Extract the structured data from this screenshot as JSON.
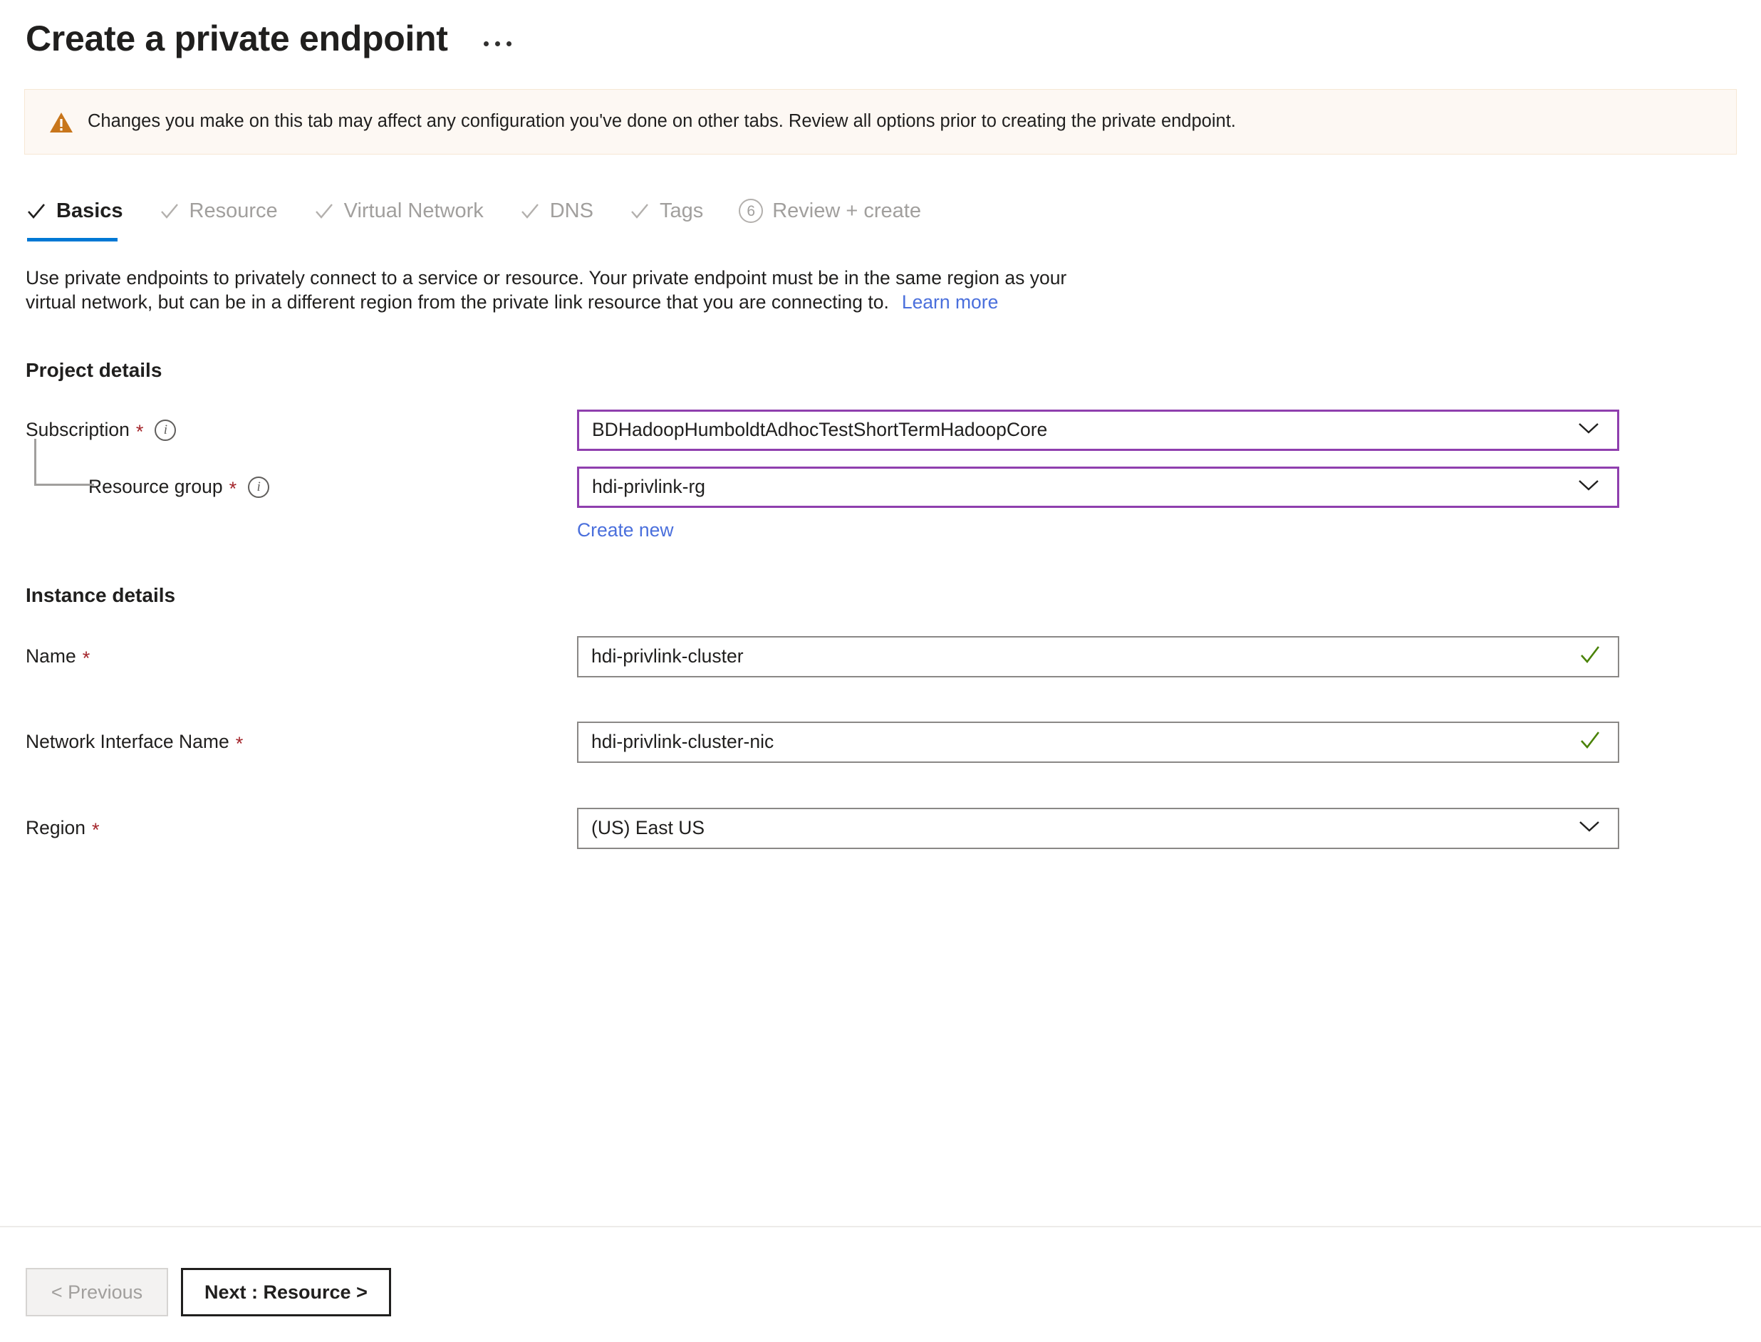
{
  "header": {
    "title": "Create a private endpoint",
    "more_actions": "…"
  },
  "warning": {
    "icon": "warning-triangle-icon",
    "text": "Changes you make on this tab may affect any configuration you've done on other tabs. Review all options prior to creating the private endpoint.",
    "background_color": "#fdf8f3",
    "icon_color": "#c8761b"
  },
  "tabs": [
    {
      "label": "Basics",
      "mark": "check",
      "state": "active"
    },
    {
      "label": "Resource",
      "mark": "check",
      "state": "complete"
    },
    {
      "label": "Virtual Network",
      "mark": "check",
      "state": "complete"
    },
    {
      "label": "DNS",
      "mark": "check",
      "state": "complete"
    },
    {
      "label": "Tags",
      "mark": "check",
      "state": "complete"
    },
    {
      "label": "Review + create",
      "mark": "number",
      "number": "6",
      "state": "pending"
    }
  ],
  "intro": {
    "line1": "Use private endpoints to privately connect to a service or resource. Your private endpoint must be in the same region as your",
    "line2": "virtual network, but can be in a different region from the private link resource that you are connecting to.",
    "learn_more": "Learn more"
  },
  "project_details": {
    "heading": "Project details",
    "subscription": {
      "label": "Subscription",
      "required": "*",
      "info": "i",
      "value": "BDHadoopHumboldtAdhocTestShortTermHadoopCore",
      "control": "dropdown",
      "border_color": "#8f3fae"
    },
    "resource_group": {
      "label": "Resource group",
      "required": "*",
      "info": "i",
      "value": "hdi-privlink-rg",
      "control": "dropdown",
      "border_color": "#8f3fae",
      "create_new": "Create new"
    }
  },
  "instance_details": {
    "heading": "Instance details",
    "name": {
      "label": "Name",
      "required": "*",
      "value": "hdi-privlink-cluster",
      "control": "textbox",
      "validation": "valid",
      "validation_color": "#498205"
    },
    "network_interface_name": {
      "label": "Network Interface Name",
      "required": "*",
      "value": "hdi-privlink-cluster-nic",
      "control": "textbox",
      "validation": "valid",
      "validation_color": "#498205"
    },
    "region": {
      "label": "Region",
      "required": "*",
      "value": "(US) East US",
      "control": "dropdown"
    }
  },
  "footer": {
    "previous_label": "< Previous",
    "previous_disabled": true,
    "next_label": "Next : Resource >"
  },
  "accent_color": "#0078d4"
}
